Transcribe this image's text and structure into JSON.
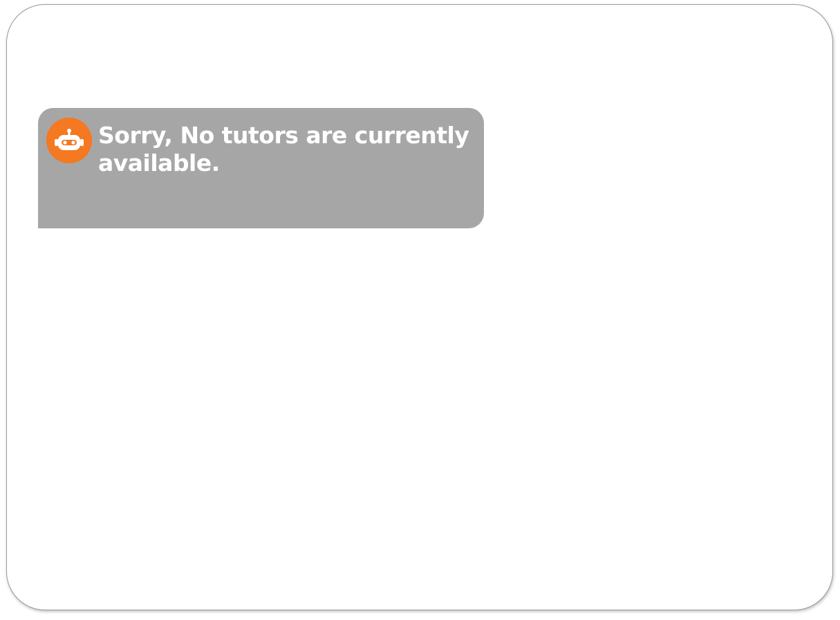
{
  "chat": {
    "messages": [
      {
        "sender": "bot",
        "avatar_icon": "robot-icon",
        "avatar_color": "#f47920",
        "bubble_color": "#a6a6a6",
        "text": "Sorry, No tutors are currently available."
      }
    ]
  }
}
